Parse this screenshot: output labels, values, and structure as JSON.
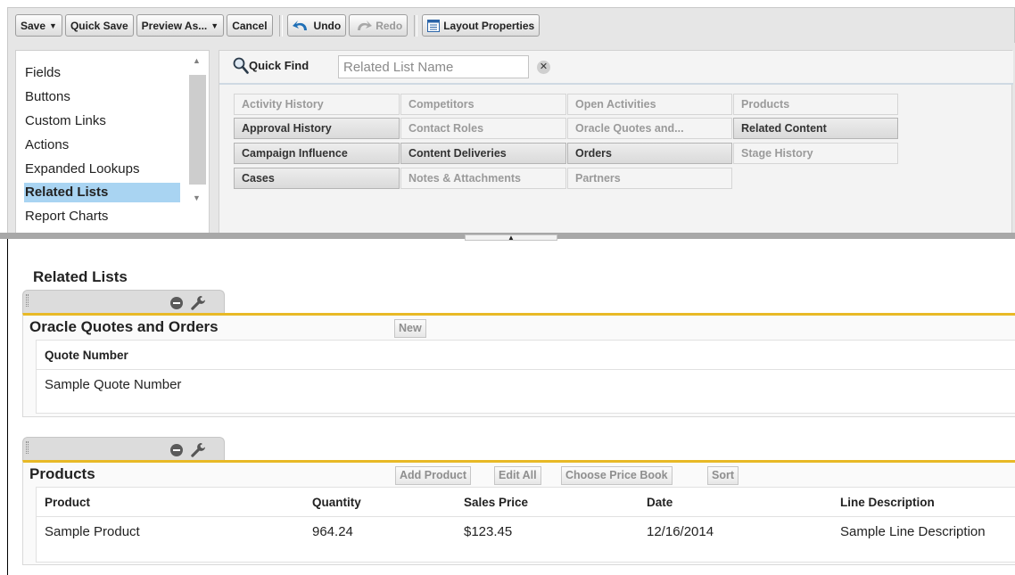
{
  "toolbar": {
    "save": "Save",
    "quick_save": "Quick Save",
    "preview_as": "Preview As...",
    "cancel": "Cancel",
    "undo": "Undo",
    "redo": "Redo",
    "layout_properties": "Layout Properties"
  },
  "palette": {
    "categories": [
      "Fields",
      "Buttons",
      "Custom Links",
      "Actions",
      "Expanded Lookups",
      "Related Lists",
      "Report Charts"
    ],
    "selected_category": "Related Lists",
    "quick_find_label": "Quick Find",
    "quick_find_placeholder": "Related List Name",
    "items": [
      {
        "label": "Activity History",
        "available": false
      },
      {
        "label": "Approval History",
        "available": true
      },
      {
        "label": "Campaign Influence",
        "available": true
      },
      {
        "label": "Cases",
        "available": true
      },
      {
        "label": "Competitors",
        "available": false
      },
      {
        "label": "Contact Roles",
        "available": false
      },
      {
        "label": "Content Deliveries",
        "available": true
      },
      {
        "label": "Notes & Attachments",
        "available": false
      },
      {
        "label": "Open Activities",
        "available": false
      },
      {
        "label": "Oracle Quotes and...",
        "available": false
      },
      {
        "label": "Orders",
        "available": true
      },
      {
        "label": "Partners",
        "available": false
      },
      {
        "label": "Products",
        "available": false
      },
      {
        "label": "Related Content",
        "available": true
      },
      {
        "label": "Stage History",
        "available": false
      }
    ]
  },
  "canvas": {
    "section_title": "Related Lists",
    "oracle": {
      "title": "Oracle Quotes and Orders",
      "new_button": "New",
      "columns": [
        "Quote Number"
      ],
      "row": [
        "Sample Quote Number"
      ]
    },
    "products": {
      "title": "Products",
      "buttons": [
        "Add Product",
        "Edit All",
        "Choose Price Book",
        "Sort"
      ],
      "columns": [
        "Product",
        "Quantity",
        "Sales Price",
        "Date",
        "Line Description"
      ],
      "row": [
        "Sample Product",
        "964.24",
        "$123.45",
        "12/16/2014",
        "Sample Line Description"
      ]
    }
  },
  "colors": {
    "selected_category": "#a9d4f2",
    "related_list_accent": "#e8b926"
  }
}
